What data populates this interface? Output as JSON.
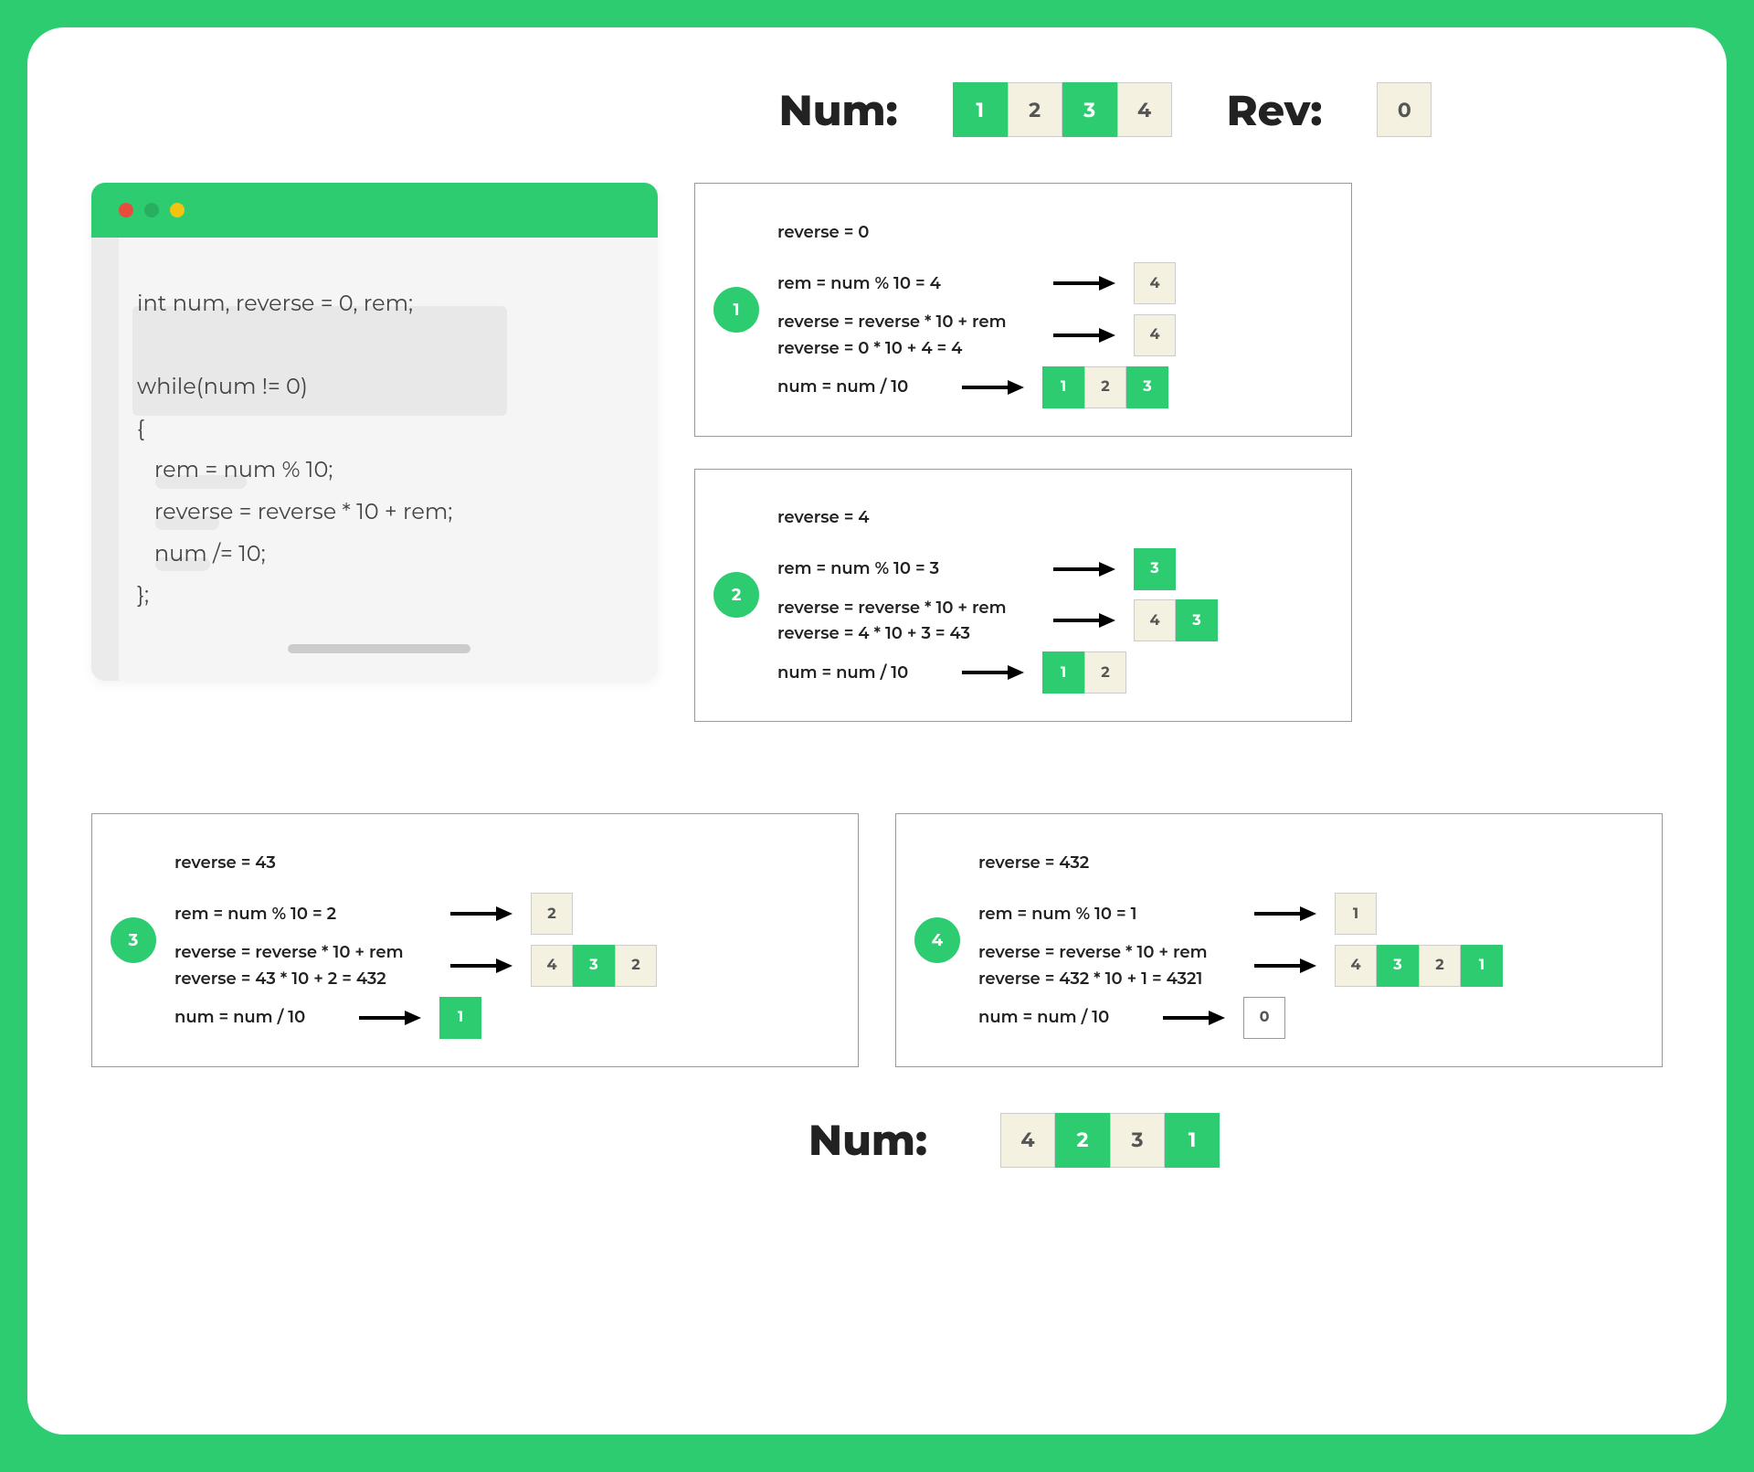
{
  "header": {
    "num_label": "Num:",
    "rev_label": "Rev:",
    "num_digits": [
      {
        "v": "1",
        "c": "green"
      },
      {
        "v": "2",
        "c": "cream"
      },
      {
        "v": "3",
        "c": "green"
      },
      {
        "v": "4",
        "c": "cream"
      }
    ],
    "rev_digits": [
      {
        "v": "0",
        "c": "cream"
      }
    ]
  },
  "code": {
    "lines": [
      "int num, reverse = 0, rem;",
      "",
      "while(num != 0)",
      "{",
      "   rem = num % 10;",
      "   reverse = reverse * 10 + rem;",
      "   num /= 10;",
      "};"
    ]
  },
  "steps": [
    {
      "n": "1",
      "r1": "reverse = 0",
      "r2": "rem = num % 10 = 4",
      "r2_digits": [
        {
          "v": "4",
          "c": "cream"
        }
      ],
      "r3a": "reverse = reverse * 10 + rem",
      "r3b": "reverse = 0 * 10 + 4 = 4",
      "r3_digits": [
        {
          "v": "4",
          "c": "cream"
        }
      ],
      "r4": "num = num / 10",
      "r4_digits": [
        {
          "v": "1",
          "c": "green"
        },
        {
          "v": "2",
          "c": "cream"
        },
        {
          "v": "3",
          "c": "green"
        }
      ]
    },
    {
      "n": "2",
      "r1": "reverse = 4",
      "r2": "rem = num % 10 = 3",
      "r2_digits": [
        {
          "v": "3",
          "c": "green"
        }
      ],
      "r3a": "reverse = reverse * 10 + rem",
      "r3b": "reverse = 4 * 10 + 3 = 43",
      "r3_digits": [
        {
          "v": "4",
          "c": "cream"
        },
        {
          "v": "3",
          "c": "green"
        }
      ],
      "r4": "num = num / 10",
      "r4_digits": [
        {
          "v": "1",
          "c": "green"
        },
        {
          "v": "2",
          "c": "cream"
        }
      ]
    },
    {
      "n": "3",
      "r1": "reverse = 43",
      "r2": "rem = num % 10 = 2",
      "r2_digits": [
        {
          "v": "2",
          "c": "cream"
        }
      ],
      "r3a": "reverse = reverse * 10 + rem",
      "r3b": "reverse = 43 * 10 + 2 = 432",
      "r3_digits": [
        {
          "v": "4",
          "c": "cream"
        },
        {
          "v": "3",
          "c": "green"
        },
        {
          "v": "2",
          "c": "cream"
        }
      ],
      "r4": "num = num / 10",
      "r4_digits": [
        {
          "v": "1",
          "c": "green"
        }
      ]
    },
    {
      "n": "4",
      "r1": "reverse = 432",
      "r2": "rem = num % 10 = 1",
      "r2_digits": [
        {
          "v": "1",
          "c": "cream"
        }
      ],
      "r3a": "reverse = reverse * 10 + rem",
      "r3b": "reverse = 432 * 10 + 1 = 4321",
      "r3_digits": [
        {
          "v": "4",
          "c": "cream"
        },
        {
          "v": "3",
          "c": "green"
        },
        {
          "v": "2",
          "c": "cream"
        },
        {
          "v": "1",
          "c": "green"
        }
      ],
      "r4": "num = num / 10",
      "r4_digits": [
        {
          "v": "0",
          "c": "white"
        }
      ]
    }
  ],
  "footer": {
    "label": "Num:",
    "digits": [
      {
        "v": "4",
        "c": "cream"
      },
      {
        "v": "2",
        "c": "green"
      },
      {
        "v": "3",
        "c": "cream"
      },
      {
        "v": "1",
        "c": "green"
      }
    ]
  }
}
